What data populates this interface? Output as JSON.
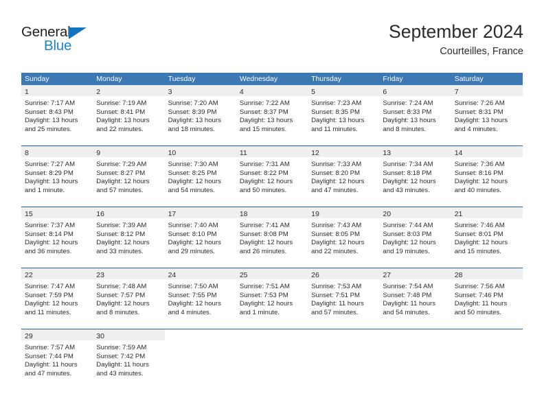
{
  "brand": {
    "name_top": "General",
    "name_bottom": "Blue",
    "accent_color": "#1b84d0",
    "triangle_color": "#1175c0"
  },
  "header": {
    "title": "September 2024",
    "subtitle": "Courteilles, France"
  },
  "theme": {
    "header_row_color": "#3b78b4",
    "week_divider_color": "#1d62a8",
    "day_band_color": "#efefef",
    "text_color": "#2b2b2b"
  },
  "weekdays": [
    "Sunday",
    "Monday",
    "Tuesday",
    "Wednesday",
    "Thursday",
    "Friday",
    "Saturday"
  ],
  "weeks": [
    [
      {
        "day": "1",
        "sunrise": "Sunrise: 7:17 AM",
        "sunset": "Sunset: 8:43 PM",
        "daylight1": "Daylight: 13 hours",
        "daylight2": "and 25 minutes."
      },
      {
        "day": "2",
        "sunrise": "Sunrise: 7:19 AM",
        "sunset": "Sunset: 8:41 PM",
        "daylight1": "Daylight: 13 hours",
        "daylight2": "and 22 minutes."
      },
      {
        "day": "3",
        "sunrise": "Sunrise: 7:20 AM",
        "sunset": "Sunset: 8:39 PM",
        "daylight1": "Daylight: 13 hours",
        "daylight2": "and 18 minutes."
      },
      {
        "day": "4",
        "sunrise": "Sunrise: 7:22 AM",
        "sunset": "Sunset: 8:37 PM",
        "daylight1": "Daylight: 13 hours",
        "daylight2": "and 15 minutes."
      },
      {
        "day": "5",
        "sunrise": "Sunrise: 7:23 AM",
        "sunset": "Sunset: 8:35 PM",
        "daylight1": "Daylight: 13 hours",
        "daylight2": "and 11 minutes."
      },
      {
        "day": "6",
        "sunrise": "Sunrise: 7:24 AM",
        "sunset": "Sunset: 8:33 PM",
        "daylight1": "Daylight: 13 hours",
        "daylight2": "and 8 minutes."
      },
      {
        "day": "7",
        "sunrise": "Sunrise: 7:26 AM",
        "sunset": "Sunset: 8:31 PM",
        "daylight1": "Daylight: 13 hours",
        "daylight2": "and 4 minutes."
      }
    ],
    [
      {
        "day": "8",
        "sunrise": "Sunrise: 7:27 AM",
        "sunset": "Sunset: 8:29 PM",
        "daylight1": "Daylight: 13 hours",
        "daylight2": "and 1 minute."
      },
      {
        "day": "9",
        "sunrise": "Sunrise: 7:29 AM",
        "sunset": "Sunset: 8:27 PM",
        "daylight1": "Daylight: 12 hours",
        "daylight2": "and 57 minutes."
      },
      {
        "day": "10",
        "sunrise": "Sunrise: 7:30 AM",
        "sunset": "Sunset: 8:25 PM",
        "daylight1": "Daylight: 12 hours",
        "daylight2": "and 54 minutes."
      },
      {
        "day": "11",
        "sunrise": "Sunrise: 7:31 AM",
        "sunset": "Sunset: 8:22 PM",
        "daylight1": "Daylight: 12 hours",
        "daylight2": "and 50 minutes."
      },
      {
        "day": "12",
        "sunrise": "Sunrise: 7:33 AM",
        "sunset": "Sunset: 8:20 PM",
        "daylight1": "Daylight: 12 hours",
        "daylight2": "and 47 minutes."
      },
      {
        "day": "13",
        "sunrise": "Sunrise: 7:34 AM",
        "sunset": "Sunset: 8:18 PM",
        "daylight1": "Daylight: 12 hours",
        "daylight2": "and 43 minutes."
      },
      {
        "day": "14",
        "sunrise": "Sunrise: 7:36 AM",
        "sunset": "Sunset: 8:16 PM",
        "daylight1": "Daylight: 12 hours",
        "daylight2": "and 40 minutes."
      }
    ],
    [
      {
        "day": "15",
        "sunrise": "Sunrise: 7:37 AM",
        "sunset": "Sunset: 8:14 PM",
        "daylight1": "Daylight: 12 hours",
        "daylight2": "and 36 minutes."
      },
      {
        "day": "16",
        "sunrise": "Sunrise: 7:39 AM",
        "sunset": "Sunset: 8:12 PM",
        "daylight1": "Daylight: 12 hours",
        "daylight2": "and 33 minutes."
      },
      {
        "day": "17",
        "sunrise": "Sunrise: 7:40 AM",
        "sunset": "Sunset: 8:10 PM",
        "daylight1": "Daylight: 12 hours",
        "daylight2": "and 29 minutes."
      },
      {
        "day": "18",
        "sunrise": "Sunrise: 7:41 AM",
        "sunset": "Sunset: 8:08 PM",
        "daylight1": "Daylight: 12 hours",
        "daylight2": "and 26 minutes."
      },
      {
        "day": "19",
        "sunrise": "Sunrise: 7:43 AM",
        "sunset": "Sunset: 8:05 PM",
        "daylight1": "Daylight: 12 hours",
        "daylight2": "and 22 minutes."
      },
      {
        "day": "20",
        "sunrise": "Sunrise: 7:44 AM",
        "sunset": "Sunset: 8:03 PM",
        "daylight1": "Daylight: 12 hours",
        "daylight2": "and 19 minutes."
      },
      {
        "day": "21",
        "sunrise": "Sunrise: 7:46 AM",
        "sunset": "Sunset: 8:01 PM",
        "daylight1": "Daylight: 12 hours",
        "daylight2": "and 15 minutes."
      }
    ],
    [
      {
        "day": "22",
        "sunrise": "Sunrise: 7:47 AM",
        "sunset": "Sunset: 7:59 PM",
        "daylight1": "Daylight: 12 hours",
        "daylight2": "and 11 minutes."
      },
      {
        "day": "23",
        "sunrise": "Sunrise: 7:48 AM",
        "sunset": "Sunset: 7:57 PM",
        "daylight1": "Daylight: 12 hours",
        "daylight2": "and 8 minutes."
      },
      {
        "day": "24",
        "sunrise": "Sunrise: 7:50 AM",
        "sunset": "Sunset: 7:55 PM",
        "daylight1": "Daylight: 12 hours",
        "daylight2": "and 4 minutes."
      },
      {
        "day": "25",
        "sunrise": "Sunrise: 7:51 AM",
        "sunset": "Sunset: 7:53 PM",
        "daylight1": "Daylight: 12 hours",
        "daylight2": "and 1 minute."
      },
      {
        "day": "26",
        "sunrise": "Sunrise: 7:53 AM",
        "sunset": "Sunset: 7:51 PM",
        "daylight1": "Daylight: 11 hours",
        "daylight2": "and 57 minutes."
      },
      {
        "day": "27",
        "sunrise": "Sunrise: 7:54 AM",
        "sunset": "Sunset: 7:48 PM",
        "daylight1": "Daylight: 11 hours",
        "daylight2": "and 54 minutes."
      },
      {
        "day": "28",
        "sunrise": "Sunrise: 7:56 AM",
        "sunset": "Sunset: 7:46 PM",
        "daylight1": "Daylight: 11 hours",
        "daylight2": "and 50 minutes."
      }
    ],
    [
      {
        "day": "29",
        "sunrise": "Sunrise: 7:57 AM",
        "sunset": "Sunset: 7:44 PM",
        "daylight1": "Daylight: 11 hours",
        "daylight2": "and 47 minutes."
      },
      {
        "day": "30",
        "sunrise": "Sunrise: 7:59 AM",
        "sunset": "Sunset: 7:42 PM",
        "daylight1": "Daylight: 11 hours",
        "daylight2": "and 43 minutes."
      },
      {
        "day": "",
        "sunrise": "",
        "sunset": "",
        "daylight1": "",
        "daylight2": ""
      },
      {
        "day": "",
        "sunrise": "",
        "sunset": "",
        "daylight1": "",
        "daylight2": ""
      },
      {
        "day": "",
        "sunrise": "",
        "sunset": "",
        "daylight1": "",
        "daylight2": ""
      },
      {
        "day": "",
        "sunrise": "",
        "sunset": "",
        "daylight1": "",
        "daylight2": ""
      },
      {
        "day": "",
        "sunrise": "",
        "sunset": "",
        "daylight1": "",
        "daylight2": ""
      }
    ]
  ]
}
